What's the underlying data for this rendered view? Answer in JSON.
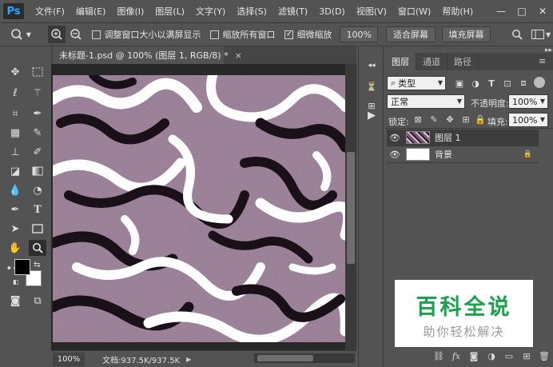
{
  "app": {
    "logo": "Ps"
  },
  "menu": [
    "文件(F)",
    "编辑(E)",
    "图像(I)",
    "图层(L)",
    "文字(Y)",
    "选择(S)",
    "滤镜(T)",
    "3D(D)",
    "视图(V)",
    "窗口(W)",
    "帮助(H)"
  ],
  "window_controls": {
    "minimize": "—",
    "maximize": "□",
    "close": "✕"
  },
  "options_bar": {
    "resize_windows_label": "调整窗口大小以满屏显示",
    "resize_windows_checked": false,
    "zoom_all_label": "缩放所有窗口",
    "zoom_all_checked": false,
    "scrubby_label": "细微缩放",
    "scrubby_checked": true,
    "btn_100": "100%",
    "btn_fit": "适合屏幕",
    "btn_fill": "填充屏幕"
  },
  "document": {
    "tab_title": "未标题-1.psd @ 100% (图层 1, RGB/8) *",
    "tab_close": "×",
    "zoom": "100%",
    "doc_info": "文档:937.5K/937.5K"
  },
  "layers_panel": {
    "tabs": [
      "图层",
      "通道",
      "路径"
    ],
    "filter_kind": "类型",
    "blend_mode": "正常",
    "opacity_label": "不透明度:",
    "opacity_value": "100%",
    "lock_label": "锁定:",
    "fill_label": "填充:",
    "fill_value": "100%",
    "layers": [
      {
        "name": "图层 1",
        "visible": true,
        "selected": true,
        "locked": false
      },
      {
        "name": "背景",
        "visible": true,
        "selected": false,
        "locked": true
      }
    ]
  },
  "watermark": {
    "title": "百科全说",
    "subtitle": "助你轻松解决"
  },
  "colors": {
    "ui_bg": "#535353",
    "foreground": "#000000",
    "background": "#ffffff",
    "canvas_base": "#8a6f88",
    "selected_layer": "#3d3d3d",
    "watermark_green": "#16a34a"
  }
}
